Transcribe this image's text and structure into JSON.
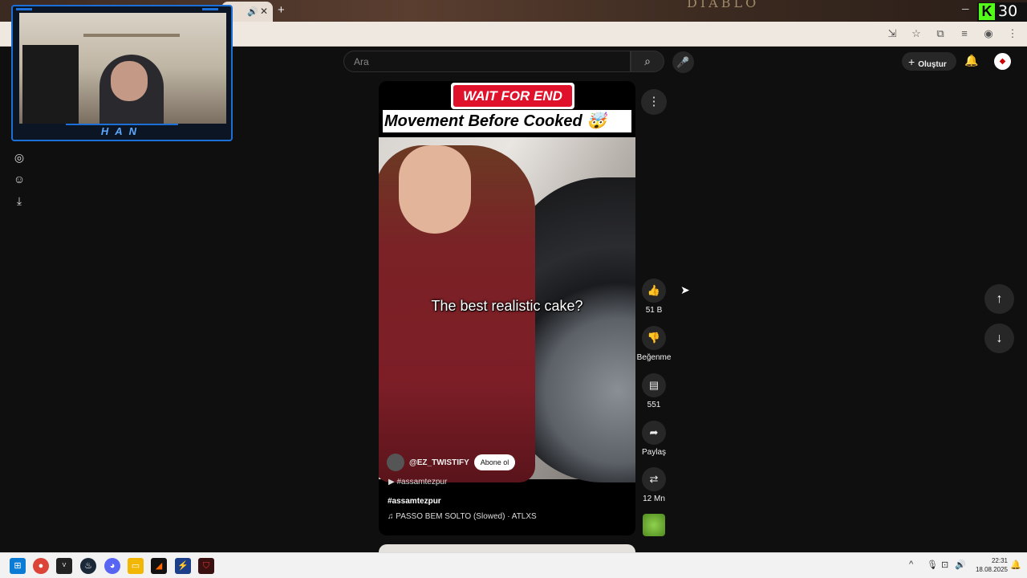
{
  "youtube": {
    "search_placeholder": "Ara",
    "create_label": "Oluştur"
  },
  "stream": {
    "kick_count": "30",
    "webcam_name": "HAN"
  },
  "short": {
    "banner_top": "WAIT FOR END 🤯",
    "headline": "Movement Before Cooked 🤯",
    "caption": "The best realistic cake?",
    "channel": "@EZ_TWISTIFY",
    "subscribe_label": "Abone ol",
    "tag_row": "#assamtezpur",
    "hashtag": "#assamtezpur",
    "music": "PASSO BEM SOLTO (Slowed) · ATLXS"
  },
  "actions": {
    "like_count": "51 B",
    "dislike_label": "Beğenme",
    "comment_count": "551",
    "share_label": "Paylaş",
    "remix_count": "12 Mn"
  },
  "taskbar": {
    "time": "22:31",
    "date": "18.08.2025"
  }
}
